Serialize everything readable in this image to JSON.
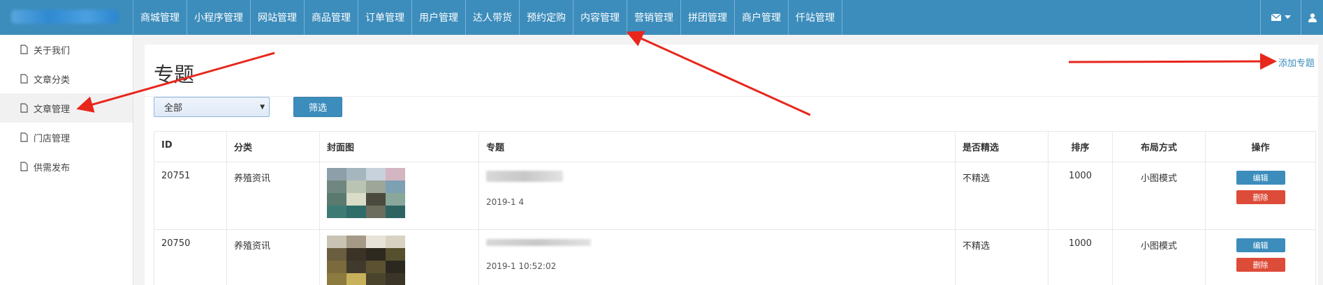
{
  "nav": {
    "items": [
      "商城管理",
      "小程序管理",
      "网站管理",
      "商品管理",
      "订单管理",
      "用户管理",
      "达人带货",
      "预约定购",
      "内容管理",
      "营销管理",
      "拼团管理",
      "商户管理",
      "仟站管理"
    ],
    "mail_icon": "envelope-icon",
    "user_icon": "user-icon"
  },
  "sidebar": {
    "items": [
      "关于我们",
      "文章分类",
      "文章管理",
      "门店管理",
      "供需发布"
    ],
    "active_index": 2,
    "item_icon": "file-icon"
  },
  "page": {
    "title": "专题",
    "add_link": "添加专题",
    "filter_select": "全部",
    "filter_button": "筛选"
  },
  "table": {
    "headers": [
      "ID",
      "分类",
      "封面图",
      "专题",
      "是否精选",
      "排序",
      "布局方式",
      "操作"
    ],
    "rows": [
      {
        "id": "20751",
        "category": "养殖资讯",
        "time": "2019-1        4",
        "featured": "不精选",
        "order": "1000",
        "layout": "小图模式",
        "edit": "编辑",
        "delete": "删除"
      },
      {
        "id": "20750",
        "category": "养殖资讯",
        "time": "2019-1        10:52:02",
        "featured": "不精选",
        "order": "1000",
        "layout": "小图模式",
        "edit": "编辑",
        "delete": "删除"
      }
    ]
  },
  "colors": {
    "primary": "#3c8dbc",
    "danger": "#dd4b39",
    "annotation": "#e8261c"
  }
}
